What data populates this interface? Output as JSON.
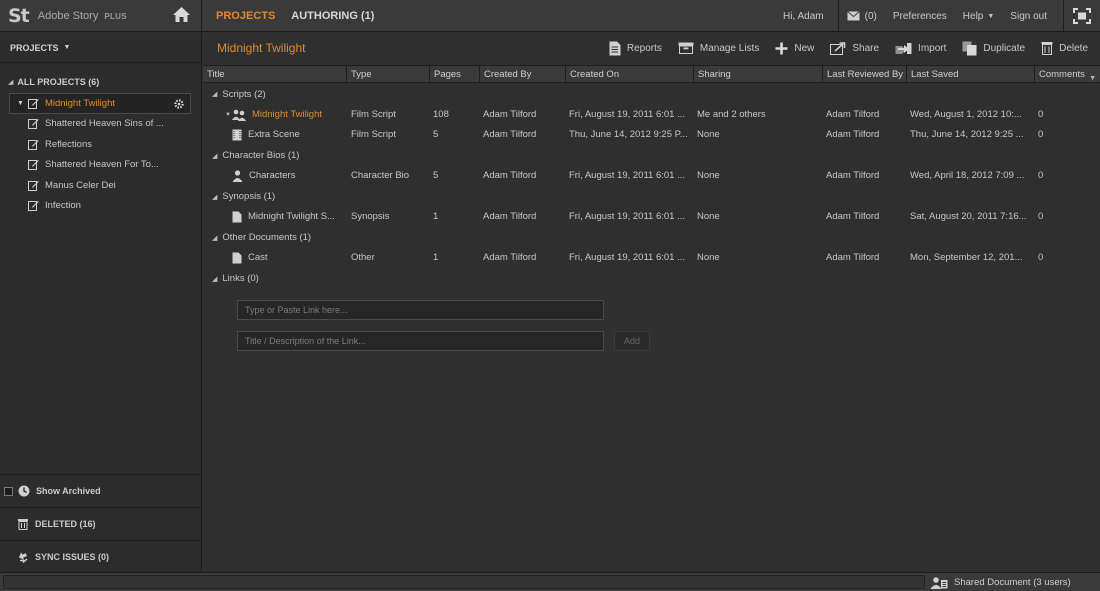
{
  "brand": {
    "logo": "St",
    "app_name": "Adobe Story",
    "plus": "PLUS"
  },
  "top_tabs": {
    "projects": "PROJECTS",
    "authoring": "AUTHORING (1)"
  },
  "top_right": {
    "greeting": "Hi, Adam",
    "messages_count": "(0)",
    "preferences": "Preferences",
    "help": "Help",
    "sign_out": "Sign out"
  },
  "sidebar": {
    "header": "PROJECTS",
    "all_projects": "ALL PROJECTS (6)",
    "projects": [
      {
        "label": "Midnight Twilight",
        "selected": true
      },
      {
        "label": "Shattered Heaven Sins of ..."
      },
      {
        "label": "Reflections"
      },
      {
        "label": "Shattered Heaven For To..."
      },
      {
        "label": "Manus Celer Dei"
      },
      {
        "label": "Infection"
      }
    ],
    "show_archived": "Show Archived",
    "deleted": "DELETED (16)",
    "sync_issues": "SYNC ISSUES (0)"
  },
  "main": {
    "title": "Midnight Twilight",
    "toolbar": {
      "reports": "Reports",
      "manage_lists": "Manage Lists",
      "new": "New",
      "share": "Share",
      "import": "Import",
      "duplicate": "Duplicate",
      "delete": "Delete"
    },
    "columns": [
      "Title",
      "Type",
      "Pages",
      "Created By",
      "Created On",
      "Sharing",
      "Last Reviewed By",
      "Last Saved",
      "Comments"
    ],
    "groups": [
      {
        "label": "Scripts (2)",
        "rows": [
          {
            "title": "Midnight Twilight",
            "type": "Film Script",
            "pages": "108",
            "created_by": "Adam Tilford",
            "created_on": "Fri, August 19, 2011 6:01 ...",
            "sharing": "Me and 2 others",
            "last_reviewed_by": "Adam Tilford",
            "last_saved": "Wed, August 1, 2012 10:...",
            "comments": "0"
          },
          {
            "title": "Extra Scene",
            "type": "Film Script",
            "pages": "5",
            "created_by": "Adam Tilford",
            "created_on": "Thu, June 14, 2012 9:25 P...",
            "sharing": "None",
            "last_reviewed_by": "Adam Tilford",
            "last_saved": "Thu, June 14, 2012 9:25 ...",
            "comments": "0"
          }
        ]
      },
      {
        "label": "Character Bios (1)",
        "rows": [
          {
            "title": "Characters",
            "type": "Character Bio",
            "pages": "5",
            "created_by": "Adam Tilford",
            "created_on": "Fri, August 19, 2011 6:01 ...",
            "sharing": "None",
            "last_reviewed_by": "Adam Tilford",
            "last_saved": "Wed, April 18, 2012 7:09 ...",
            "comments": "0"
          }
        ]
      },
      {
        "label": "Synopsis (1)",
        "rows": [
          {
            "title": "Midnight Twilight S...",
            "type": "Synopsis",
            "pages": "1",
            "created_by": "Adam Tilford",
            "created_on": "Fri, August 19, 2011 6:01 ...",
            "sharing": "None",
            "last_reviewed_by": "Adam Tilford",
            "last_saved": "Sat, August 20, 2011 7:16...",
            "comments": "0"
          }
        ]
      },
      {
        "label": "Other Documents (1)",
        "rows": [
          {
            "title": "Cast",
            "type": "Other",
            "pages": "1",
            "created_by": "Adam Tilford",
            "created_on": "Fri, August 19, 2011 6:01 ...",
            "sharing": "None",
            "last_reviewed_by": "Adam Tilford",
            "last_saved": "Mon, September 12, 201...",
            "comments": "0"
          }
        ]
      }
    ],
    "links_label": "Links (0)",
    "link_input_placeholder": "Type or Paste Link here...",
    "link_title_placeholder": "Title / Description of the Link...",
    "add_button": "Add"
  },
  "status": {
    "shared_document": "Shared Document (3 users)"
  },
  "colors": {
    "accent": "#e08a2c",
    "background": "#2f2f2f",
    "panel": "#3a3a3a"
  }
}
